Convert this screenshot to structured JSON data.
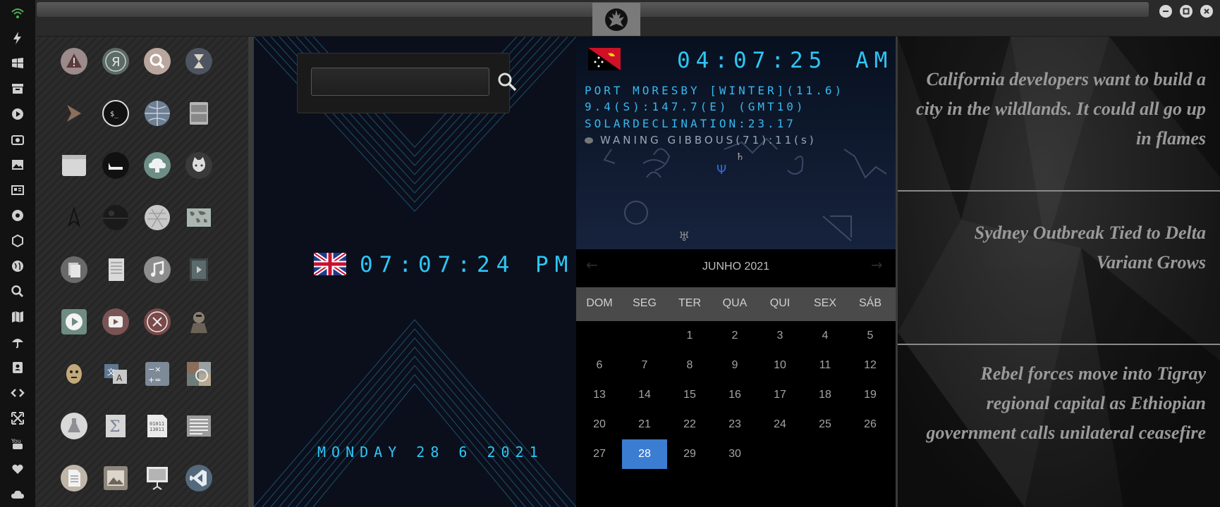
{
  "window": {
    "minimize": "minimize",
    "maximize": "maximize",
    "close": "close"
  },
  "dock": [
    "wifi-icon",
    "lightning-icon",
    "windows-icon",
    "archive-icon",
    "play-icon",
    "camera-icon",
    "image-icon",
    "news-icon",
    "aperture-icon",
    "hexagon-icon",
    "globe-icon",
    "search-icon",
    "map-icon",
    "umbrella-icon",
    "contact-icon",
    "code-icon",
    "expand-icon",
    "youtube-icon",
    "heart-icon",
    "cloud-icon"
  ],
  "search": {
    "placeholder": "",
    "value": ""
  },
  "local_clock": {
    "time": "07:07:24 PM",
    "date": "MONDAY 28 6 2021"
  },
  "world_clock": {
    "time": "04:07:25",
    "ampm": "AM",
    "location": "PORT MORESBY [WINTER](11.6)",
    "coords": "9.4(S):147.7(E) (GMT10)",
    "declination": "SOLARDECLINATION:23.17",
    "moon": "WANING GIBBOUS(71):11(s)"
  },
  "calendar": {
    "title": "JUNHO 2021",
    "weekdays": [
      "DOM",
      "SEG",
      "TER",
      "QUA",
      "QUI",
      "SEX",
      "SÁB"
    ],
    "weeks": [
      [
        "",
        "",
        "1",
        "2",
        "3",
        "4",
        "5"
      ],
      [
        "6",
        "7",
        "8",
        "9",
        "10",
        "11",
        "12"
      ],
      [
        "13",
        "14",
        "15",
        "16",
        "17",
        "18",
        "19"
      ],
      [
        "20",
        "21",
        "22",
        "23",
        "24",
        "25",
        "26"
      ],
      [
        "27",
        "28",
        "29",
        "30",
        "",
        "",
        ""
      ]
    ],
    "today": "28",
    "accent": "#3b7dd1"
  },
  "news": [
    "California developers want to build a city in the wildlands. It could all go up in flames",
    "Sydney Outbreak Tied to Delta Variant Grows",
    "Rebel forces move into Tigray regional capital as Ethiopian government calls unilateral ceasefire"
  ],
  "colors": {
    "digital": "#2ec6f5",
    "wifi": "#4caf50"
  }
}
